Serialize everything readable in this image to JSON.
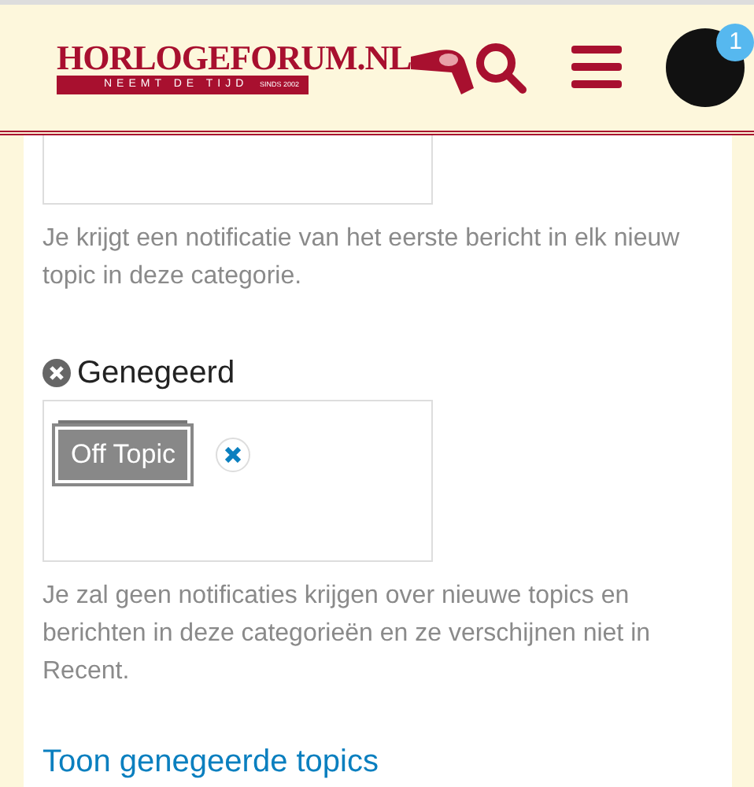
{
  "header": {
    "logo": {
      "title": "HORLOGEFORUM.NL",
      "tagline": "NEEMT DE TIJD",
      "since": "SINDS 2002"
    },
    "notification_count": "1"
  },
  "watching_first_post": {
    "description": "Je krijgt een notificatie van het eerste bericht in elk nieuw topic in deze categorie."
  },
  "ignored": {
    "title": "Genegeerd",
    "categories": [
      {
        "name": "Off Topic"
      }
    ],
    "description": "Je zal geen notificaties krijgen over nieuwe topics en berichten in deze categorieën en ze verschijnen niet in Recent."
  },
  "link": "Toon genegeerde topics"
}
